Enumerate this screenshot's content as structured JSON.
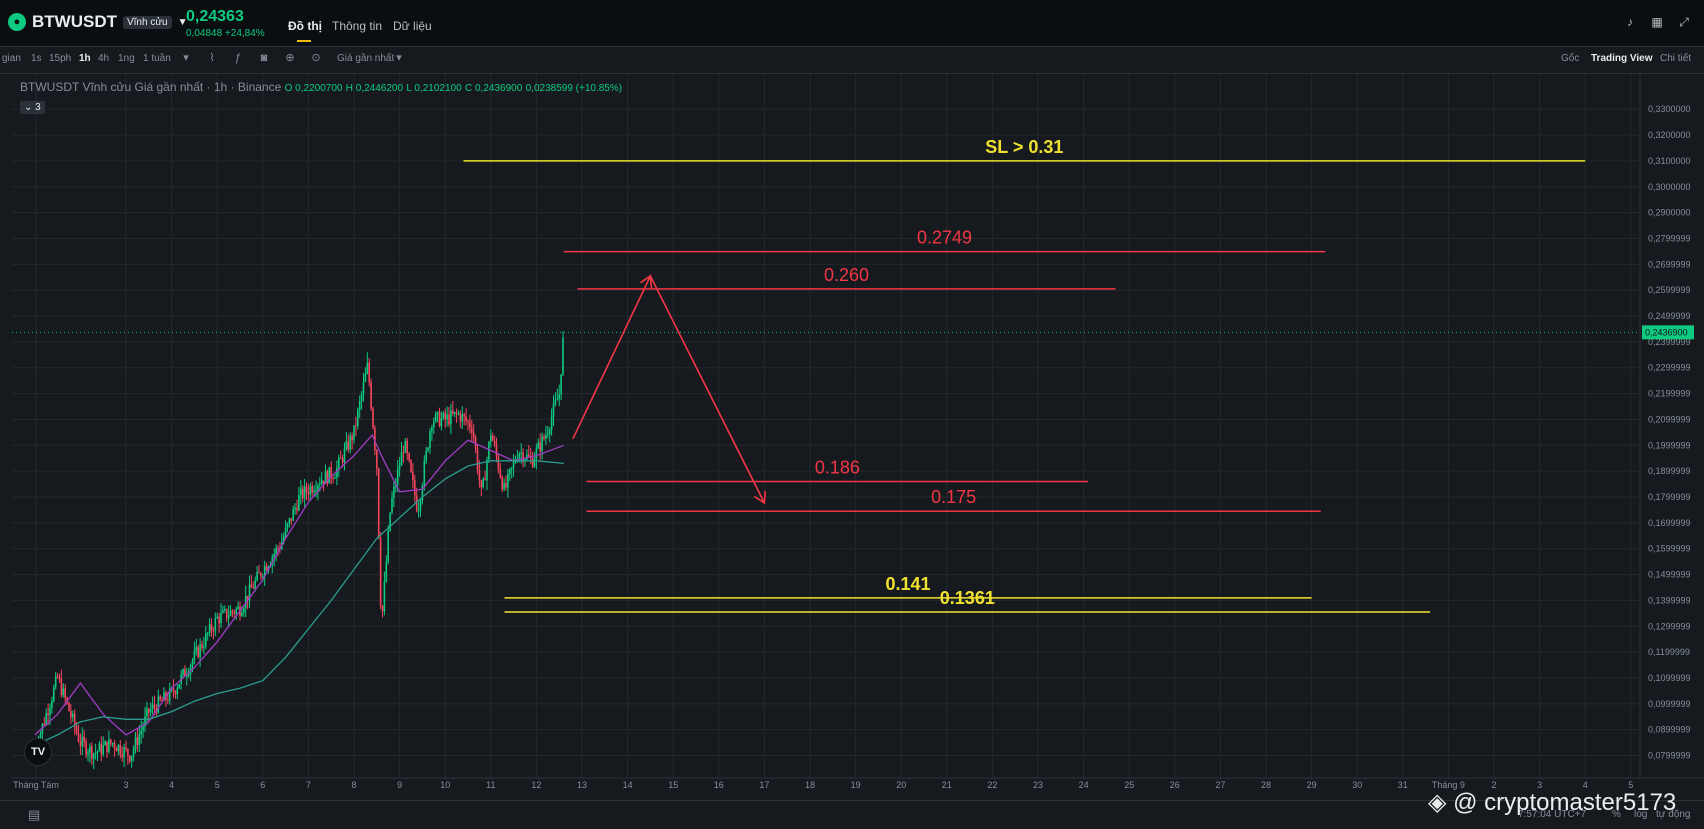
{
  "header": {
    "symbol": "BTWUSDT",
    "contract_badge": "Vĩnh cửu",
    "last_price": "0,24363",
    "change": "0,04848 +24,84%",
    "tabs": [
      "Đồ thị",
      "Thông tin",
      "Dữ liệu"
    ],
    "active_tab": "Đồ thị"
  },
  "toolbar": {
    "time_label": "gian",
    "intervals": [
      "1s",
      "15ph",
      "1h",
      "4h",
      "1ng",
      "1 tuần"
    ],
    "active_interval": "1h",
    "price_type": "Giá gần nhất",
    "views": [
      "Gốc",
      "Trading View",
      "Chi tiết"
    ],
    "active_view": "Trading View"
  },
  "legend": {
    "title": "BTWUSDT Vĩnh cửu Giá gần nhất · 1h · Binance",
    "open": "O 0,2200700",
    "high": "H 0,2446200",
    "low": "L 0,2102100",
    "close": "C 0,2436900",
    "delta": "0,0238599 (+10.85%)",
    "indicator_count": "3"
  },
  "chart_data": {
    "type": "candlestick",
    "y_axis_ticks": [
      "0,3300000",
      "0,3200000",
      "0,3100000",
      "0,3000000",
      "0,2900000",
      "0,2799999",
      "0,2699999",
      "0,2599999",
      "0,2499999",
      "0,2399999",
      "0,2299999",
      "0,2199999",
      "0,2099999",
      "0,1999999",
      "0,1899999",
      "0,1799999",
      "0,1699999",
      "0,1599999",
      "0,1499999",
      "0,1399999",
      "0,1299999",
      "0,1199999",
      "0,1099999",
      "0,0999999",
      "0,0899999",
      "0,0799999"
    ],
    "y_tick_values": [
      0.33,
      0.32,
      0.31,
      0.3,
      0.29,
      0.28,
      0.27,
      0.26,
      0.25,
      0.24,
      0.23,
      0.22,
      0.21,
      0.2,
      0.19,
      0.18,
      0.17,
      0.16,
      0.15,
      0.14,
      0.13,
      0.12,
      0.11,
      0.1,
      0.09,
      0.08
    ],
    "ylim": [
      0.0775,
      0.3355
    ],
    "x_axis_ticks": [
      "Tháng Tám",
      "3",
      "4",
      "5",
      "6",
      "7",
      "8",
      "9",
      "10",
      "11",
      "12",
      "13",
      "14",
      "15",
      "16",
      "17",
      "18",
      "19",
      "20",
      "21",
      "22",
      "23",
      "24",
      "25",
      "26",
      "27",
      "28",
      "29",
      "30",
      "31",
      "Tháng 9",
      "2",
      "3",
      "4",
      "5"
    ],
    "current_price_label": "0,2436900",
    "current_price": 0.24369,
    "annotations": [
      {
        "label": "SL > 0.31",
        "value": 0.31,
        "color": "#f0e130",
        "from_day": 10.4,
        "to_day": 35.0
      },
      {
        "label": "0.2749",
        "value": 0.2749,
        "color": "#f23645",
        "from_day": 12.6,
        "to_day": 29.3
      },
      {
        "label": "0.260",
        "value": 0.2605,
        "color": "#f23645",
        "from_day": 12.9,
        "to_day": 24.7
      },
      {
        "label": "0.186",
        "value": 0.186,
        "color": "#f23645",
        "from_day": 13.1,
        "to_day": 24.1
      },
      {
        "label": "0.175",
        "value": 0.1745,
        "color": "#f23645",
        "from_day": 13.1,
        "to_day": 29.2
      },
      {
        "label": "0.141",
        "value": 0.141,
        "color": "#f0e130",
        "from_day": 11.3,
        "to_day": 29.0
      },
      {
        "label": "0.1361",
        "value": 0.1355,
        "color": "#f0e130",
        "from_day": 11.3,
        "to_day": 31.6
      }
    ],
    "projection_path": [
      [
        12.8,
        0.2025
      ],
      [
        14.5,
        0.2655
      ],
      [
        17.0,
        0.1777
      ]
    ],
    "ma_series": [
      {
        "color": "#a13cc4",
        "points": [
          [
            1.0,
            0.088
          ],
          [
            1.5,
            0.096
          ],
          [
            2.0,
            0.108
          ],
          [
            2.5,
            0.096
          ],
          [
            3.0,
            0.088
          ],
          [
            3.5,
            0.093
          ],
          [
            4.0,
            0.106
          ],
          [
            4.5,
            0.114
          ],
          [
            5.0,
            0.124
          ],
          [
            5.5,
            0.136
          ],
          [
            6.0,
            0.148
          ],
          [
            6.5,
            0.164
          ],
          [
            7.0,
            0.178
          ],
          [
            7.5,
            0.188
          ],
          [
            8.0,
            0.196
          ],
          [
            8.4,
            0.204
          ],
          [
            8.6,
            0.196
          ],
          [
            9.0,
            0.182
          ],
          [
            9.5,
            0.183
          ],
          [
            10.0,
            0.194
          ],
          [
            10.5,
            0.202
          ],
          [
            11.0,
            0.198
          ],
          [
            11.5,
            0.194
          ],
          [
            12.0,
            0.196
          ],
          [
            12.6,
            0.2
          ]
        ]
      },
      {
        "color": "#2a9d8f",
        "points": [
          [
            1.0,
            0.084
          ],
          [
            1.5,
            0.088
          ],
          [
            2.0,
            0.093
          ],
          [
            2.5,
            0.095
          ],
          [
            3.0,
            0.094
          ],
          [
            3.5,
            0.094
          ],
          [
            4.0,
            0.097
          ],
          [
            4.5,
            0.101
          ],
          [
            5.0,
            0.104
          ],
          [
            5.5,
            0.106
          ],
          [
            6.0,
            0.109
          ],
          [
            6.5,
            0.118
          ],
          [
            7.0,
            0.129
          ],
          [
            7.5,
            0.14
          ],
          [
            8.0,
            0.152
          ],
          [
            8.5,
            0.164
          ],
          [
            9.0,
            0.172
          ],
          [
            9.5,
            0.18
          ],
          [
            10.0,
            0.187
          ],
          [
            10.5,
            0.192
          ],
          [
            11.0,
            0.194
          ],
          [
            11.5,
            0.194
          ],
          [
            12.0,
            0.194
          ],
          [
            12.6,
            0.193
          ]
        ]
      }
    ],
    "price_path": [
      [
        1.0,
        0.082
      ],
      [
        1.5,
        0.11
      ],
      [
        2.0,
        0.085
      ],
      [
        2.3,
        0.081
      ],
      [
        2.7,
        0.085
      ],
      [
        3.1,
        0.08
      ],
      [
        3.5,
        0.097
      ],
      [
        4.0,
        0.104
      ],
      [
        4.5,
        0.118
      ],
      [
        5.0,
        0.133
      ],
      [
        5.5,
        0.137
      ],
      [
        6.0,
        0.152
      ],
      [
        6.4,
        0.162
      ],
      [
        6.8,
        0.18
      ],
      [
        7.2,
        0.186
      ],
      [
        7.6,
        0.19
      ],
      [
        8.0,
        0.205
      ],
      [
        8.3,
        0.231
      ],
      [
        8.5,
        0.192
      ],
      [
        8.6,
        0.13
      ],
      [
        8.8,
        0.176
      ],
      [
        9.1,
        0.201
      ],
      [
        9.4,
        0.175
      ],
      [
        9.7,
        0.21
      ],
      [
        10.0,
        0.21
      ],
      [
        10.3,
        0.212
      ],
      [
        10.6,
        0.207
      ],
      [
        10.8,
        0.18
      ],
      [
        11.0,
        0.205
      ],
      [
        11.3,
        0.182
      ],
      [
        11.6,
        0.198
      ],
      [
        11.9,
        0.194
      ],
      [
        12.2,
        0.204
      ],
      [
        12.5,
        0.22
      ],
      [
        12.6,
        0.244
      ]
    ]
  },
  "status": {
    "time": "7:57:04 UTC+7",
    "mode": "log",
    "auto": "tự động",
    "percent": "%"
  },
  "watermark": "@ cryptomaster5173",
  "logo_text": "TV"
}
